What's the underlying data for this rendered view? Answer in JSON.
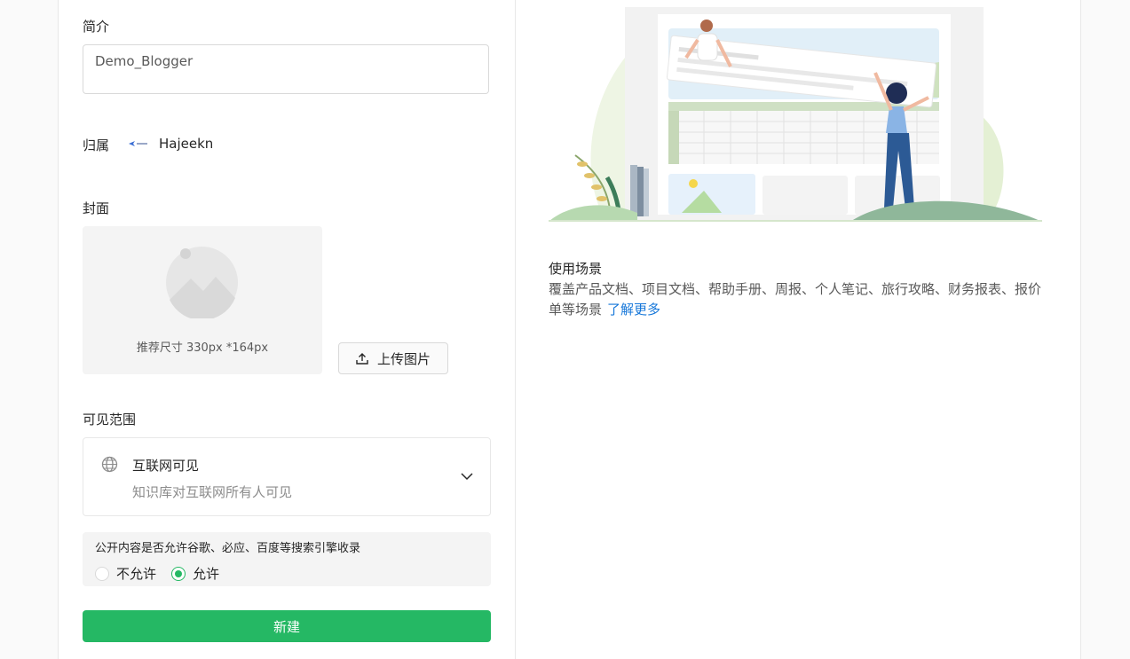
{
  "form": {
    "intro_label": "简介",
    "intro_value": "Demo_Blogger",
    "owner_label": "归属",
    "owner_name": "Hajeekn",
    "cover_label": "封面",
    "cover_hint": "推荐尺寸 330px *164px",
    "upload_label": "上传图片",
    "visibility_label": "可见范围",
    "visibility_title": "互联网可见",
    "visibility_desc": "知识库对互联网所有人可见",
    "seo_question": "公开内容是否允许谷歌、必应、百度等搜索引擎收录",
    "seo_options": [
      "不允许",
      "允许"
    ],
    "seo_selected": "允许",
    "create_label": "新建"
  },
  "side": {
    "scene_title": "使用场景",
    "scene_desc": "覆盖产品文档、项目文档、帮助手册、周报、个人笔记、旅行攻略、财务报表、报价单等场景",
    "learn_more": "了解更多"
  },
  "colors": {
    "primary": "#25b864",
    "link": "#1677d9"
  }
}
